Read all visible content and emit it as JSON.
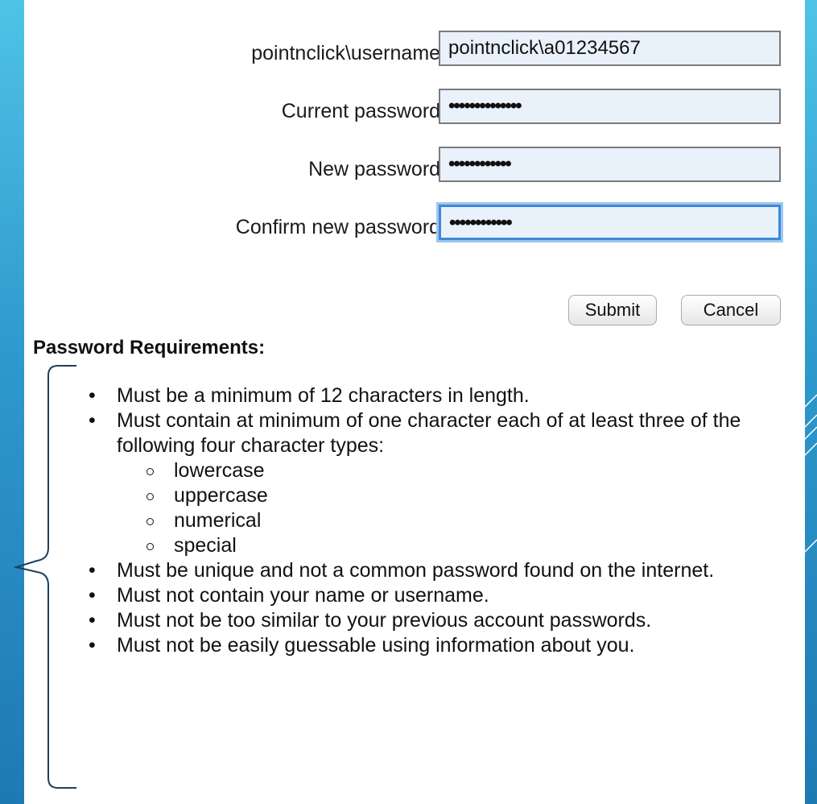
{
  "form": {
    "username_label": "pointnclick\\username:",
    "username_value": "pointnclick\\a01234567",
    "current_label": "Current password:",
    "current_value": "••••••••••••••",
    "new_label": "New password:",
    "new_value": "••••••••••••",
    "confirm_label": "Confirm new password:",
    "confirm_value": "••••••••••••",
    "submit_label": "Submit",
    "cancel_label": "Cancel"
  },
  "requirements": {
    "title": "Password Requirements:",
    "items": [
      "Must be a minimum of 12 characters in length.",
      "Must contain at minimum of one character each of at least three of the following four character types:",
      "Must be unique and not a common password found on the internet.",
      "Must not contain your name or username.",
      "Must not be too similar to your previous account passwords.",
      "Must not be easily guessable using information about you."
    ],
    "types": [
      "lowercase",
      "uppercase",
      "numerical",
      "special"
    ]
  },
  "colors": {
    "background_top": "#4fc3e6",
    "background_bottom": "#1f79b3",
    "field_fill": "#e9f1fb",
    "focus_ring": "#3f87da",
    "brace": "#1e3f5a"
  }
}
